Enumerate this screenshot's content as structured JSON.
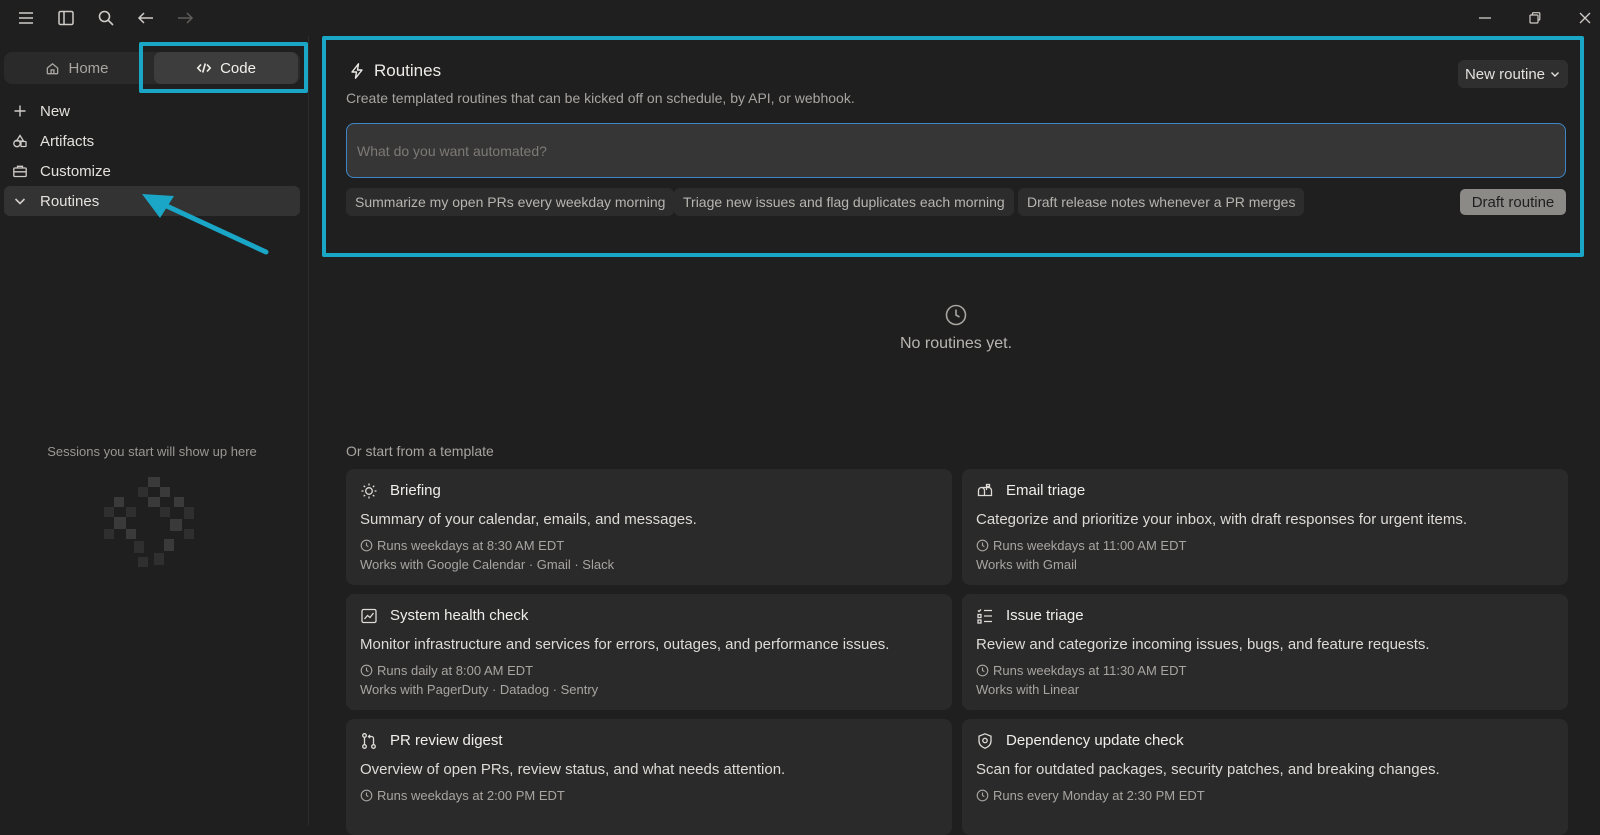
{
  "sidebar": {
    "tabs": [
      {
        "label": "Home",
        "icon": "home-icon"
      },
      {
        "label": "Code",
        "icon": "code-icon"
      }
    ],
    "items": [
      {
        "label": "New",
        "icon": "plus-icon"
      },
      {
        "label": "Artifacts",
        "icon": "shapes-icon"
      },
      {
        "label": "Customize",
        "icon": "briefcase-icon"
      },
      {
        "label": "Routines",
        "icon": "chevron-down-icon"
      }
    ],
    "sessions_note": "Sessions you start will show up here"
  },
  "routines": {
    "title": "Routines",
    "subtitle": "Create templated routines that can be kicked off on schedule, by API, or webhook.",
    "new_routine_label": "New routine",
    "input_placeholder": "What do you want automated?",
    "suggestions": [
      "Summarize my open PRs every weekday morning",
      "Triage new issues and flag duplicates each morning",
      "Draft release notes whenever a PR merges"
    ],
    "draft_button": "Draft routine"
  },
  "empty_state": {
    "text": "No routines yet."
  },
  "templates": {
    "heading": "Or start from a template",
    "cards": [
      {
        "title": "Briefing",
        "icon": "sun-icon",
        "description": "Summary of your calendar, emails, and messages.",
        "schedule": "Runs weekdays at 8:30 AM EDT",
        "works_with": "Works with Google Calendar · Gmail · Slack"
      },
      {
        "title": "Email triage",
        "icon": "mailbox-icon",
        "description": "Categorize and prioritize your inbox, with draft responses for urgent items.",
        "schedule": "Runs weekdays at 11:00 AM EDT",
        "works_with": "Works with Gmail"
      },
      {
        "title": "System health check",
        "icon": "chart-icon",
        "description": "Monitor infrastructure and services for errors, outages, and performance issues.",
        "schedule": "Runs daily at 8:00 AM EDT",
        "works_with": "Works with PagerDuty · Datadog · Sentry"
      },
      {
        "title": "Issue triage",
        "icon": "list-check-icon",
        "description": "Review and categorize incoming issues, bugs, and feature requests.",
        "schedule": "Runs weekdays at 11:30 AM EDT",
        "works_with": "Works with Linear"
      },
      {
        "title": "PR review digest",
        "icon": "git-pull-request-icon",
        "description": "Overview of open PRs, review status, and what needs attention.",
        "schedule": "Runs weekdays at 2:00 PM EDT",
        "works_with": ""
      },
      {
        "title": "Dependency update check",
        "icon": "shield-icon",
        "description": "Scan for outdated packages, security patches, and breaking changes.",
        "schedule": "Runs every Monday at 2:30 PM EDT",
        "works_with": ""
      }
    ]
  },
  "colors": {
    "background": "#1f1f1f",
    "card": "#2a2a2a",
    "highlight": "#1aa6c6",
    "input_border": "#3f86c7"
  }
}
